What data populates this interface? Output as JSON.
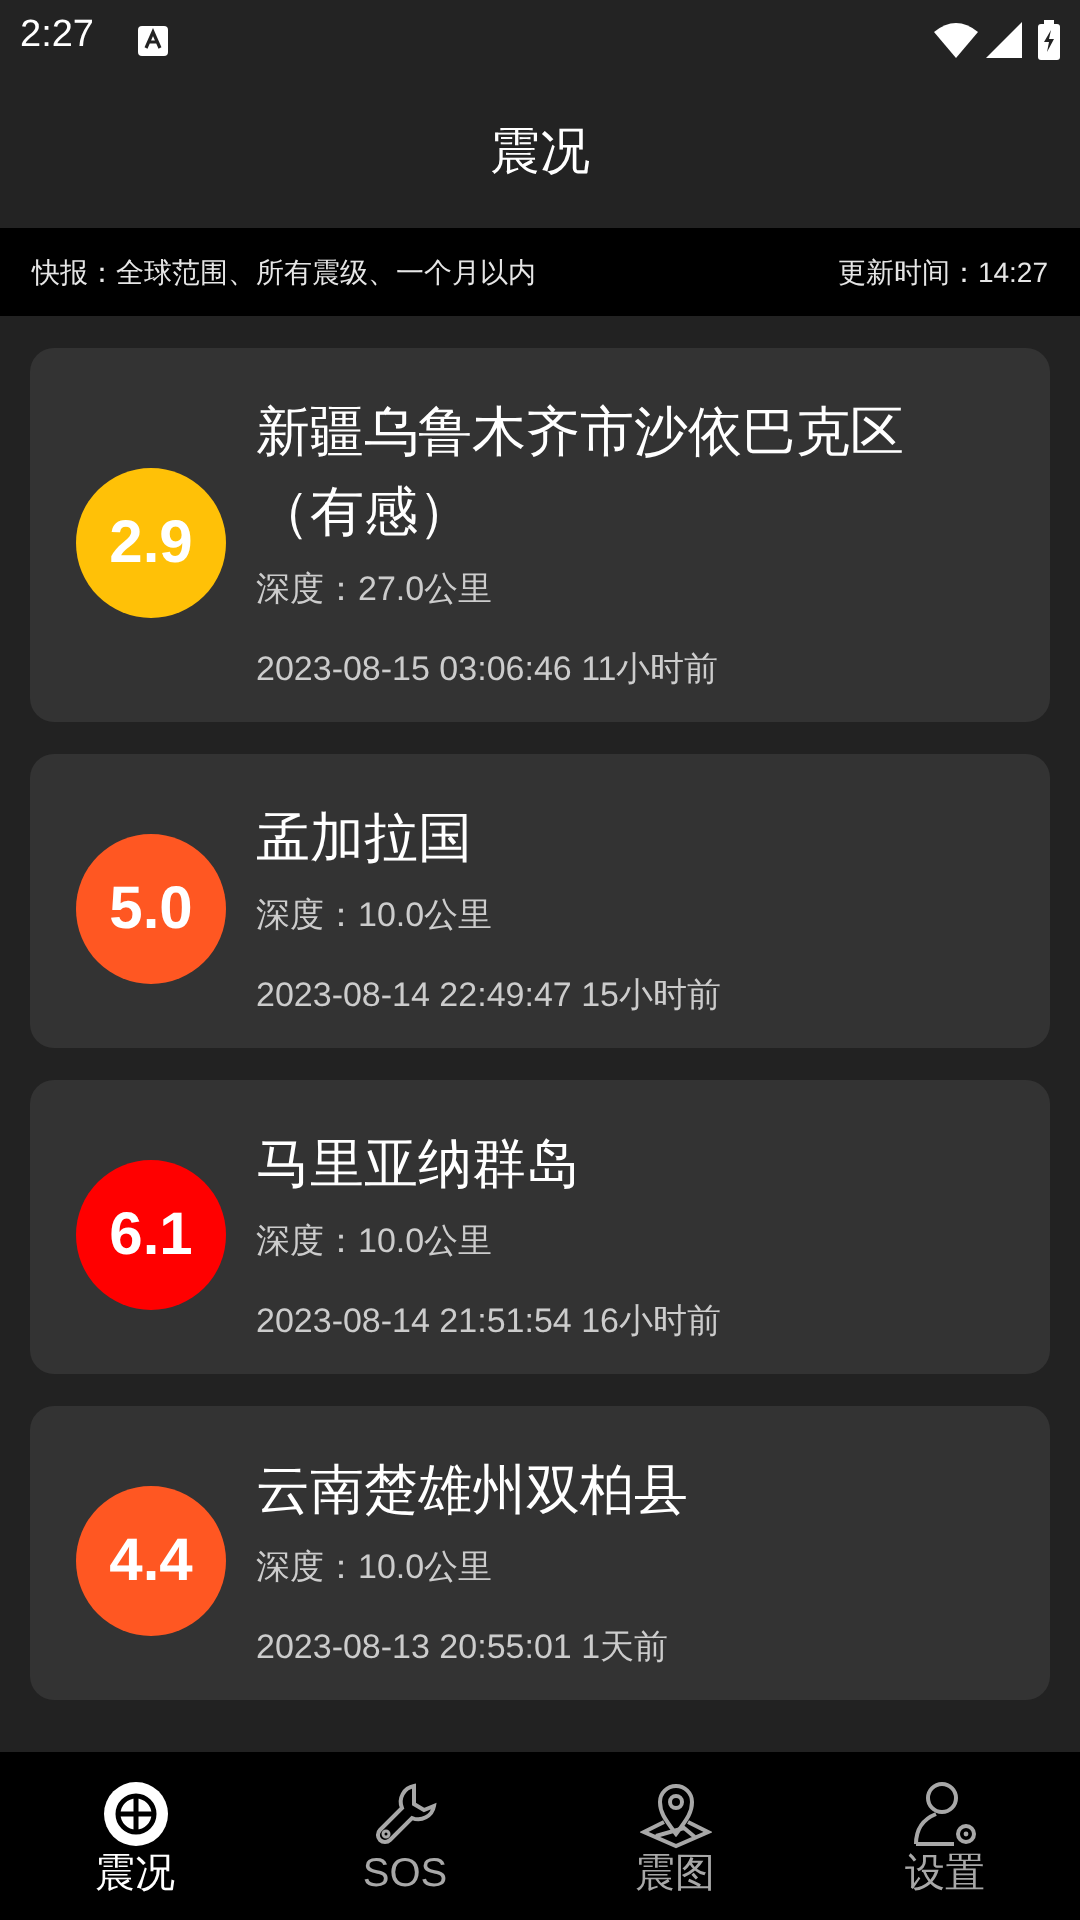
{
  "status_bar": {
    "time": "2:27"
  },
  "header": {
    "title": "震况"
  },
  "info_bar": {
    "filter": "快报：全球范围、所有震级、一个月以内",
    "updated": "更新时间：14:27"
  },
  "quakes": [
    {
      "magnitude": "2.9",
      "color": "#ffc107",
      "place": "新疆乌鲁木齐市沙依巴克区（有感）",
      "depth": "深度：27.0公里",
      "time": "2023-08-15 03:06:46 11小时前"
    },
    {
      "magnitude": "5.0",
      "color": "#ff5722",
      "place": "孟加拉国",
      "depth": "深度：10.0公里",
      "time": "2023-08-14 22:49:47 15小时前"
    },
    {
      "magnitude": "6.1",
      "color": "#ff0000",
      "place": "马里亚纳群岛",
      "depth": "深度：10.0公里",
      "time": "2023-08-14 21:51:54 16小时前"
    },
    {
      "magnitude": "4.4",
      "color": "#ff5722",
      "place": "云南楚雄州双柏县",
      "depth": "深度：10.0公里",
      "time": "2023-08-13 20:55:01 1天前"
    }
  ],
  "bottom_nav": [
    {
      "label": "震况",
      "selected": true
    },
    {
      "label": "SOS",
      "selected": false
    },
    {
      "label": "震图",
      "selected": false
    },
    {
      "label": "设置",
      "selected": false
    }
  ]
}
